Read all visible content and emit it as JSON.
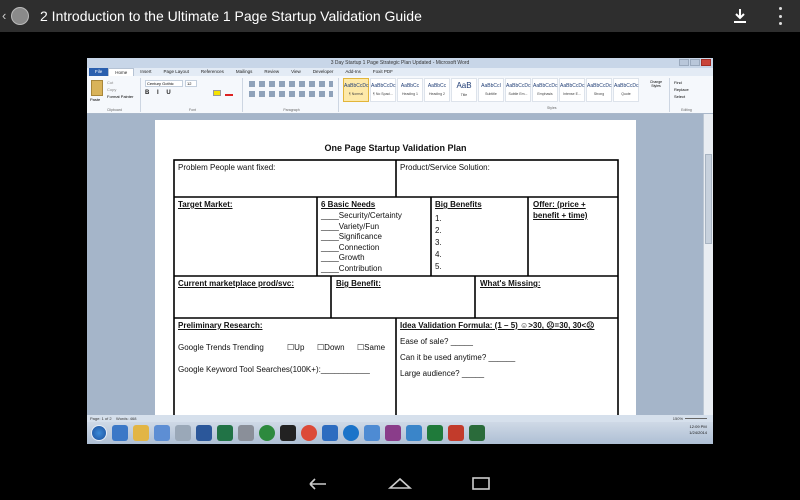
{
  "topbar": {
    "title": "2  Introduction to the Ultimate 1 Page Startup Validation Guide",
    "back_icon": "chevron-left-icon",
    "download_icon": "download-icon",
    "overflow_icon": "more-vert-icon"
  },
  "word": {
    "window_title": "3 Day Startup 1 Page Strategic Plan Updated - Microsoft Word",
    "tabs": [
      "File",
      "Home",
      "Insert",
      "Page Layout",
      "References",
      "Mailings",
      "Review",
      "View",
      "Developer",
      "Add-Ins",
      "Foxit PDF"
    ],
    "font_name": "Century Gothic",
    "font_size": "12",
    "group_labels": {
      "clipboard": "Clipboard",
      "font": "Font",
      "paragraph": "Paragraph",
      "styles": "Styles",
      "editing": "Editing"
    },
    "clipboard_items": {
      "paste": "Paste",
      "cut": "Cut",
      "copy": "Copy",
      "format_painter": "Format Painter"
    },
    "styles": [
      {
        "sample": "AaBbCcDc",
        "name": "¶ Normal"
      },
      {
        "sample": "AaBbCcDc",
        "name": "¶ No Spaci..."
      },
      {
        "sample": "AaBbCc",
        "name": "Heading 1"
      },
      {
        "sample": "AaBbCc",
        "name": "Heading 2"
      },
      {
        "sample": "AaB",
        "name": "Title"
      },
      {
        "sample": "AaBbCcI",
        "name": "Subtitle"
      },
      {
        "sample": "AaBbCcDc",
        "name": "Subtle Em..."
      },
      {
        "sample": "AaBbCcDc",
        "name": "Emphasis"
      },
      {
        "sample": "AaBbCcDc",
        "name": "Intense E..."
      },
      {
        "sample": "AaBbCcDc",
        "name": "Strong"
      },
      {
        "sample": "AaBbCcDc",
        "name": "Quote"
      }
    ],
    "change_styles": "Change Styles",
    "editing": {
      "find": "Find",
      "replace": "Replace",
      "select": "Select"
    },
    "status": {
      "page": "Page: 1 of 2",
      "words": "Words: 468",
      "zoom": "150%"
    }
  },
  "document": {
    "title": "One Page Startup Validation Plan",
    "problem_label": "Problem People want fixed:",
    "solution_label": "Product/Service  Solution:",
    "target_market_label": "Target Market:",
    "basic_needs_label": "6 Basic Needs",
    "basic_needs": [
      "____Security/Certainty",
      "____Variety/Fun",
      "____Significance",
      "____Connection",
      "____Growth",
      "____Contribution"
    ],
    "big_benefits_label": "Big Benefits",
    "big_benefits": [
      "1.",
      "2.",
      "3.",
      "4.",
      "5."
    ],
    "offer_label_1": "Offer: (price +",
    "offer_label_2": "benefit + time)",
    "marketplace_label": "Current marketplace prod/svc:",
    "big_benefit_label": "Big Benefit:",
    "whats_missing_label": "What's Missing:",
    "prelim_research_label": "Preliminary Research:",
    "google_trends_label": "Google Trends Trending",
    "trend_options": [
      "☐Up",
      "☐Down",
      "☐Same"
    ],
    "keyword_tool_label": "Google Keyword Tool Searches(100K+):___________",
    "idea_formula_label": "Idea Validation Formula: (1 – 5) ☺>30, ☹=30, 30<☹",
    "ease_of_sale": "Ease of sale? _____",
    "use_anytime": "Can it be used anytime? ______",
    "large_audience": "Large audience? _____"
  },
  "taskbar": {
    "time": "12:09 PM",
    "date": "1/24/2014"
  },
  "colors": {
    "topbar": "#2e2e2e",
    "word_file_tab": "#2a5fae",
    "ribbon_bg": "#f5f8fc",
    "doc_bg": "#a5b5c9"
  }
}
